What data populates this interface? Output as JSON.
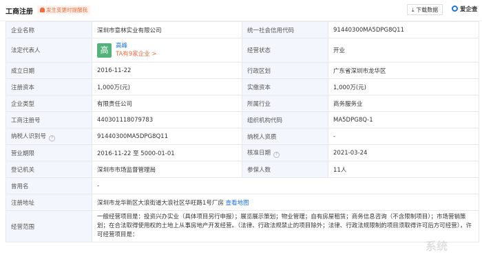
{
  "header": {
    "title": "工商注册",
    "alert": "发生变更时提醒我",
    "download_label": "下载数据",
    "brand_label": "爱企查"
  },
  "rows": {
    "r1": {
      "k1": "企业名称",
      "v1": "深圳市意林实业有限公司",
      "k2": "统一社会信用代码",
      "v2": "91440300MA5DPG8Q11"
    },
    "r2": {
      "k1": "法定代表人",
      "avatar": "高",
      "name": "高峰",
      "sub": "TA有9家企业 >",
      "k2": "经营状态",
      "v2": "开业"
    },
    "r3": {
      "k1": "成立日期",
      "v1": "2016-11-22",
      "k2": "行政区划",
      "v2": "广东省深圳市龙华区"
    },
    "r4": {
      "k1": "注册资本",
      "v1": "1,000万(元)",
      "k2": "实缴资本",
      "v2": "1,000万(元)"
    },
    "r5": {
      "k1": "企业类型",
      "v1": "有限责任公司",
      "k2": "所属行业",
      "v2": "商务服务业"
    },
    "r6": {
      "k1": "工商注册号",
      "v1": "440301118079783",
      "k2": "组织机构代码",
      "v2": "MA5DPG8Q-1"
    },
    "r7": {
      "k1": "纳税人识别号",
      "v1": "91440300MA5DPG8Q11",
      "k2": "纳税人资质",
      "v2": "-"
    },
    "r8": {
      "k1": "营业期限",
      "v1": "2016-11-22 至 5000-01-01",
      "k2": "核准日期",
      "v2": "2021-03-24"
    },
    "r9": {
      "k1": "登记机关",
      "v1": "深圳市市场监督管理局",
      "k2": "参保人数",
      "v2": "11人"
    },
    "r10": {
      "k1": "曾用名",
      "v1": "-"
    },
    "r11": {
      "k1": "注册地址",
      "v1": "深圳市龙华新区大浪街道大浪社区华旺路1号厂房",
      "link": "查看地图"
    },
    "r12": {
      "k1": "经营范围",
      "v1": "一般经营项目是：投资兴办实业（具体项目另行申报）；展览展示策划；物业管理；自有房屋租赁；商务信息咨询（不含限制项目）；市场营销策划；在合法取得使用权的土地上从事房地产开发经营。（法律、行政法规禁止的项目除外；法律、行政法规限制的项目须取得许可后方可经营），许可经营项目是："
    }
  },
  "watermark": "系统"
}
